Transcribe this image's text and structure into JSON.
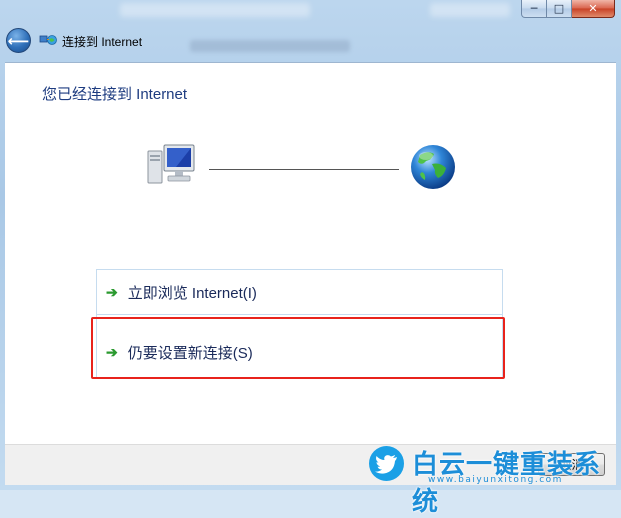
{
  "window": {
    "caption_buttons": {
      "minimize_symbol": "─",
      "maximize_symbol": "□",
      "close_symbol": "✕"
    }
  },
  "nav": {
    "back_symbol": "⟵",
    "icon": "network-connection-icon",
    "title": "连接到 Internet"
  },
  "content": {
    "heading": "您已经连接到 Internet",
    "computer_icon": "computer-icon",
    "globe_icon": "internet-globe-icon",
    "links": [
      {
        "arrow": "➔",
        "label": "立即浏览 Internet(I)"
      },
      {
        "arrow": "➔",
        "label": "仍要设置新连接(S)"
      }
    ],
    "highlight_color": "#e8231c"
  },
  "footer": {
    "cancel_label": "取消"
  },
  "watermark": {
    "text": "白云一键重装系统",
    "url": "www.baiyunxitong.com",
    "color": "#1d8ed8"
  }
}
